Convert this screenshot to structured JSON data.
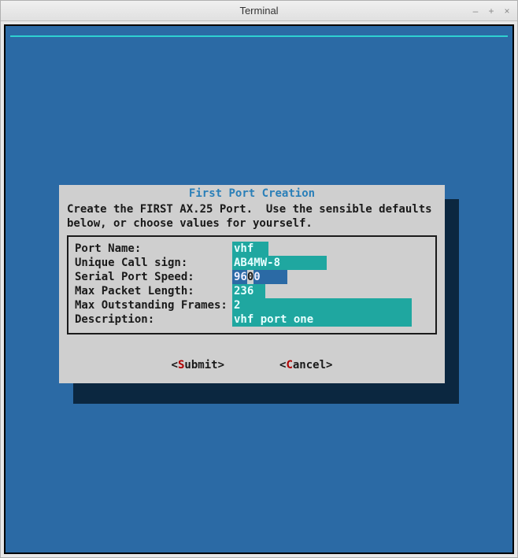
{
  "window": {
    "title": "Terminal"
  },
  "dialog": {
    "title": "First Port Creation",
    "description": "Create the FIRST AX.25 Port.  Use the sensible defaults\nbelow, or choose values for yourself."
  },
  "form": {
    "port_name": {
      "label": "Port Name:",
      "value": "vhf"
    },
    "callsign": {
      "label": "Unique Call sign:",
      "value": "AB4MW-8"
    },
    "serial_speed": {
      "label": "Serial Port Speed:",
      "value": "9600"
    },
    "max_packet_len": {
      "label": "Max Packet Length:",
      "value": "236"
    },
    "max_out_frames": {
      "label": "Max Outstanding Frames:",
      "value": "2"
    },
    "description": {
      "label": "Description:",
      "value": "vhf port one"
    }
  },
  "buttons": {
    "submit": {
      "open": "<",
      "hot": "S",
      "rest": "ubmit",
      "close": ">"
    },
    "cancel": {
      "open": "<",
      "hot": "C",
      "rest": "ancel",
      "close": ">"
    }
  }
}
